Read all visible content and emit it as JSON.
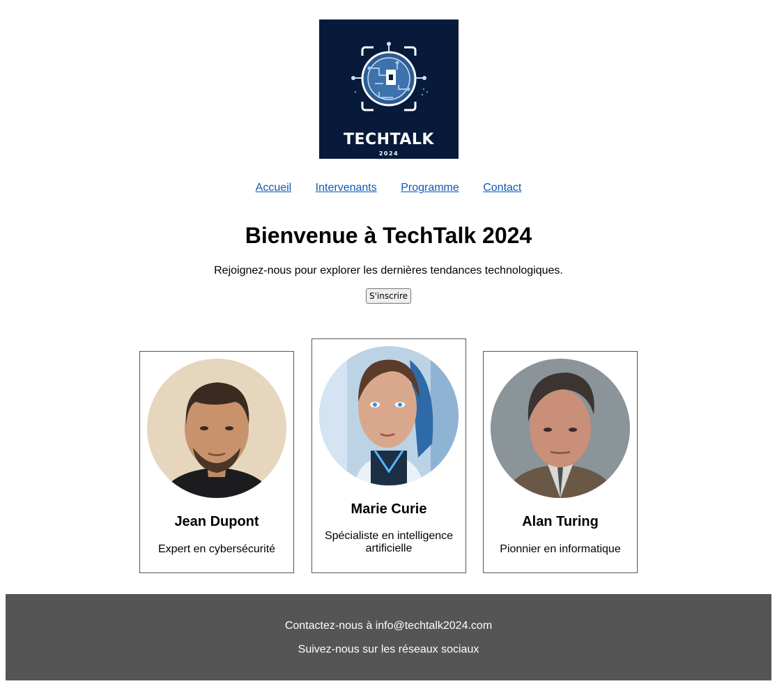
{
  "logo": {
    "title": "TECHTALK",
    "year": "2024",
    "colors": {
      "background": "#071a3a",
      "accent": "#5b8fc9"
    }
  },
  "nav": {
    "items": [
      "Accueil",
      "Intervenants",
      "Programme",
      "Contact"
    ],
    "link_color": "#0a58b8"
  },
  "hero": {
    "title": "Bienvenue à TechTalk 2024",
    "subtitle": "Rejoignez-nous pour explorer les dernières tendances technologiques.",
    "button_label": "S'inscrire"
  },
  "speakers": [
    {
      "name": "Jean Dupont",
      "role": "Expert en cybersécurité",
      "portrait": "man-portrait"
    },
    {
      "name": "Marie Curie",
      "role": "Spécialiste en intelligence artificielle",
      "portrait": "android-woman-portrait"
    },
    {
      "name": "Alan Turing",
      "role": "Pionnier en informatique",
      "portrait": "older-man-portrait"
    }
  ],
  "footer": {
    "contact": "Contactez-nous à info@techtalk2024.com",
    "social": "Suivez-nous sur les réseaux sociaux",
    "background": "#555555"
  }
}
